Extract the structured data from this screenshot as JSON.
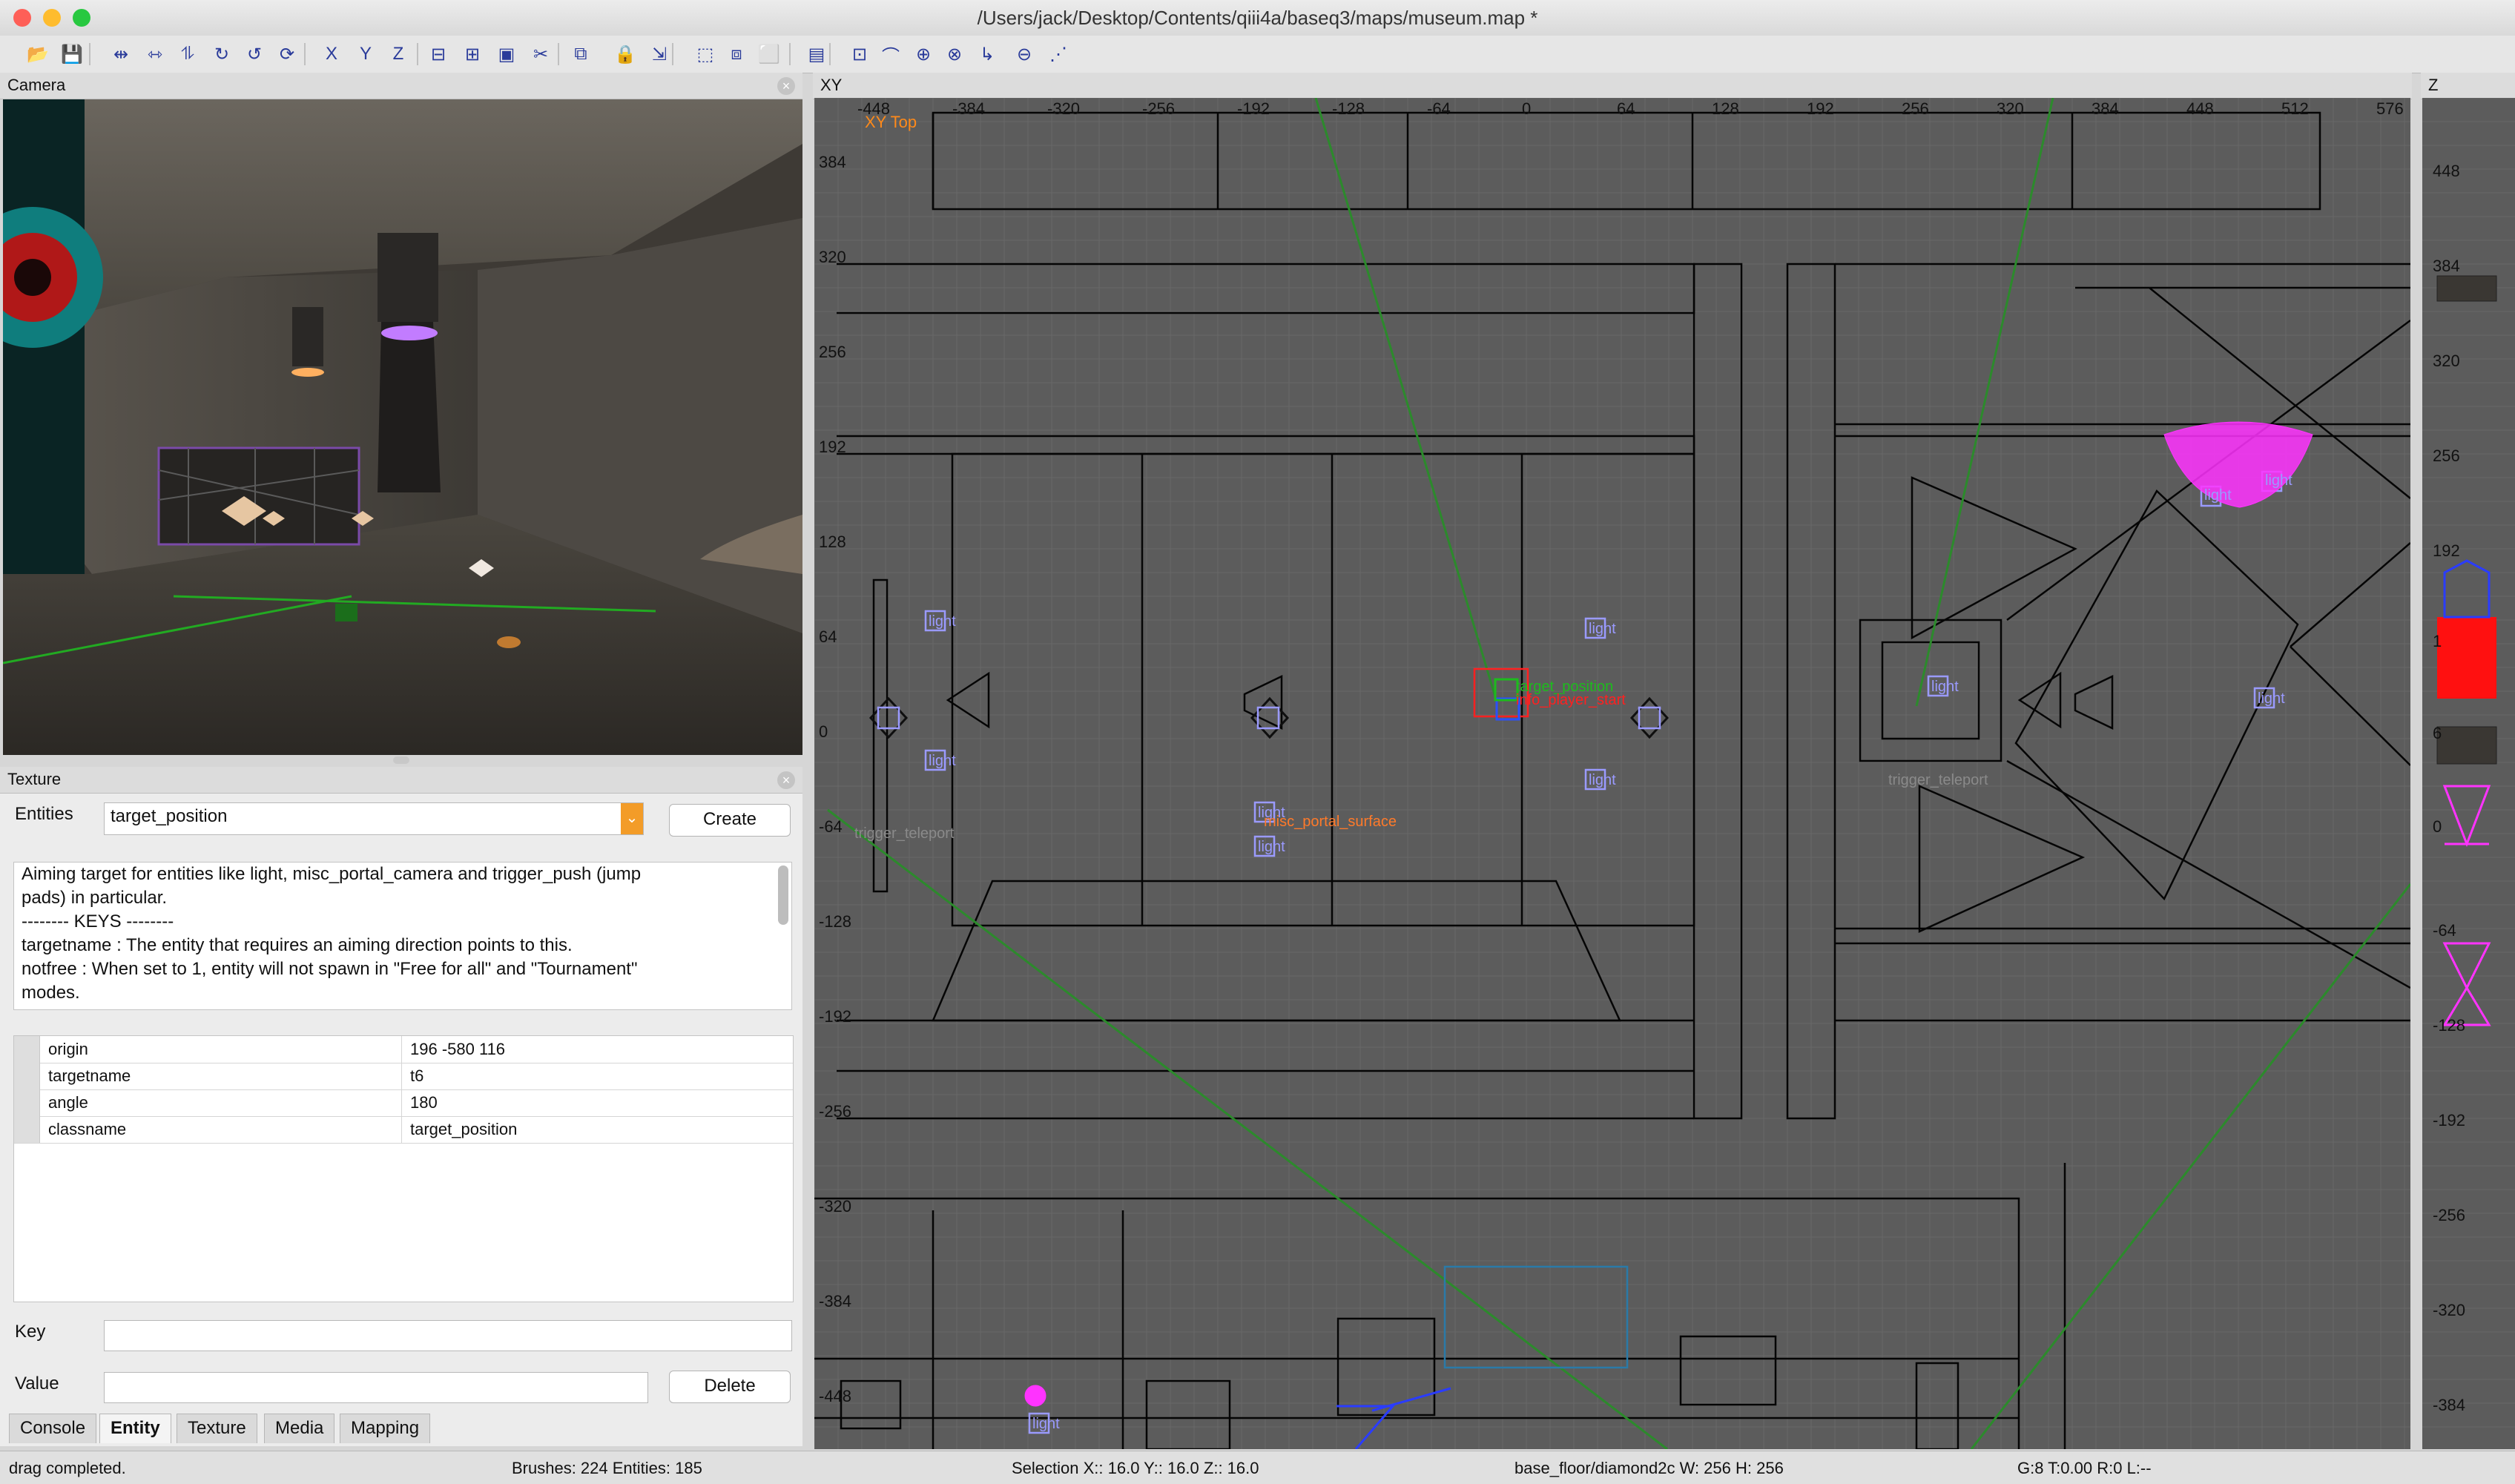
{
  "window": {
    "title": "/Users/jack/Desktop/Contents/qiii4a/baseq3/maps/museum.map *",
    "traffic_light_colors": [
      "#fe5f57",
      "#febc2e",
      "#28c840"
    ]
  },
  "toolbar": {
    "icons": [
      "open-icon",
      "save-icon",
      "flip-x-icon",
      "flip-y-icon",
      "flip-z-icon",
      "rotate-x-icon",
      "rotate-y-icon",
      "rotate-z-icon",
      "lock-x-icon",
      "lock-y-icon",
      "lock-z-icon",
      "csg-subtract-icon",
      "csg-merge-icon",
      "make-hollow-icon",
      "clipper-icon",
      "change-view-icon",
      "texture-lock-icon",
      "scale-lock-icon",
      "select-inside-icon",
      "select-touching-icon",
      "select-partial-icon",
      "camera-toggle-icon",
      "show-patch-icon",
      "patch-bend-icon",
      "patch-weld-icon",
      "patch-drill-icon",
      "patch-insert-icon",
      "patch-delete-icon",
      "vertex-mode-icon"
    ]
  },
  "camera": {
    "title": "Camera"
  },
  "entity": {
    "panel_title": "Texture",
    "entities_label": "Entities",
    "selected_class": "target_position",
    "create_label": "Create",
    "description": [
      "Aiming target for entities like light, misc_portal_camera and trigger_push (jump",
      "pads) in particular.",
      "-------- KEYS --------",
      "targetname : The entity that requires an aiming direction points to this.",
      "notfree : When set to 1, entity will not spawn in \"Free for all\" and \"Tournament\"",
      "modes."
    ],
    "properties": [
      {
        "key": "origin",
        "value": "196 -580 116"
      },
      {
        "key": "targetname",
        "value": "t6"
      },
      {
        "key": "angle",
        "value": "180"
      },
      {
        "key": "classname",
        "value": "target_position"
      }
    ],
    "key_label": "Key",
    "value_label": "Value",
    "key_value": "",
    "value_value": "",
    "delete_label": "Delete"
  },
  "tabs": [
    "Console",
    "Entity",
    "Texture",
    "Media",
    "Mapping"
  ],
  "active_tab": "Entity",
  "xy": {
    "title": "XY",
    "view_label": "XY Top",
    "x_ticks": [
      "-448",
      "-384",
      "-320",
      "-256",
      "-192",
      "-128",
      "-64",
      "0",
      "64",
      "128",
      "192",
      "256",
      "320",
      "384",
      "448",
      "512",
      "576"
    ],
    "y_ticks": [
      "384",
      "320",
      "256",
      "192",
      "128",
      "64",
      "0",
      "-64",
      "-128",
      "-192",
      "-256",
      "-320",
      "-384",
      "-448"
    ],
    "entity_labels": [
      "light",
      "light",
      "light",
      "light",
      "light",
      "light",
      "light",
      "light",
      "light",
      "light",
      "light",
      "misc_portal_surface",
      "trigger_teleport",
      "trigger_teleport",
      "target_position",
      "info_player_start"
    ],
    "colors": {
      "background": "#5c5c5c",
      "grid": "#6a6a6a",
      "brush": "#000000",
      "entity": "#8080ff",
      "path": "#2a8a2a",
      "selection": "#ff0000",
      "light": "#ff33ff"
    }
  },
  "z": {
    "title": "Z",
    "ticks": [
      "448",
      "384",
      "320",
      "256",
      "192",
      "1",
      "6",
      "0",
      "-64",
      "-128",
      "-192",
      "-256",
      "-320",
      "-384"
    ]
  },
  "status": {
    "message": "drag completed.",
    "counts": "Brushes: 224 Entities: 185",
    "selection": "Selection X:: 16.0  Y:: 16.0  Z:: 16.0",
    "texture": "base_floor/diamond2c W: 256 H: 256",
    "grid": "G:8 T:0.00 R:0 L:--"
  }
}
